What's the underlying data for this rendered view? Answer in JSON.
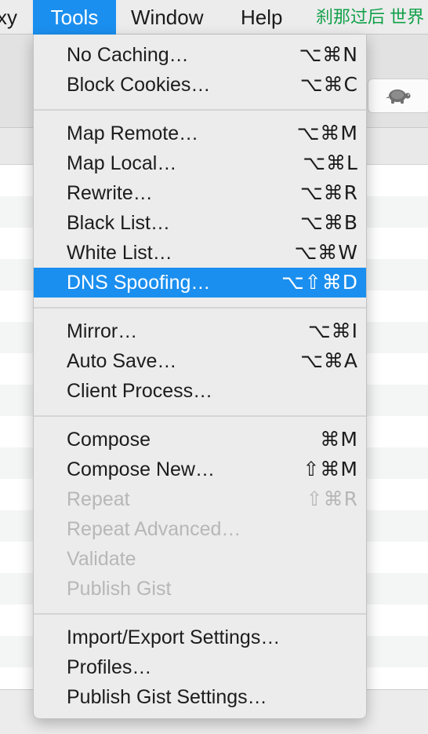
{
  "menubar": {
    "partial_label": "xy",
    "tools_label": "Tools",
    "window_label": "Window",
    "help_label": "Help",
    "status_text": "刹那过后 世界",
    "status_color": "#12a04a",
    "highlight_color": "#1b8fef"
  },
  "toolbar": {
    "throttle_icon": "turtle-icon"
  },
  "tools_menu": {
    "items": [
      {
        "label": "No Caching…",
        "shortcut": "⌥⌘N",
        "enabled": true
      },
      {
        "label": "Block Cookies…",
        "shortcut": "⌥⌘C",
        "enabled": true
      },
      {
        "label": "Map Remote…",
        "shortcut": "⌥⌘M",
        "enabled": true
      },
      {
        "label": "Map Local…",
        "shortcut": "⌥⌘L",
        "enabled": true
      },
      {
        "label": "Rewrite…",
        "shortcut": "⌥⌘R",
        "enabled": true
      },
      {
        "label": "Black List…",
        "shortcut": "⌥⌘B",
        "enabled": true
      },
      {
        "label": "White List…",
        "shortcut": "⌥⌘W",
        "enabled": true
      },
      {
        "label": "DNS Spoofing…",
        "shortcut": "⌥⇧⌘D",
        "enabled": true,
        "highlighted": true
      },
      {
        "label": "Mirror…",
        "shortcut": "⌥⌘I",
        "enabled": true
      },
      {
        "label": "Auto Save…",
        "shortcut": "⌥⌘A",
        "enabled": true
      },
      {
        "label": "Client Process…",
        "shortcut": "",
        "enabled": true
      },
      {
        "label": "Compose",
        "shortcut": "⌘M",
        "enabled": true
      },
      {
        "label": "Compose New…",
        "shortcut": "⇧⌘M",
        "enabled": true
      },
      {
        "label": "Repeat",
        "shortcut": "⇧⌘R",
        "enabled": false
      },
      {
        "label": "Repeat Advanced…",
        "shortcut": "",
        "enabled": false
      },
      {
        "label": "Validate",
        "shortcut": "",
        "enabled": false
      },
      {
        "label": "Publish Gist",
        "shortcut": "",
        "enabled": false
      },
      {
        "label": "Import/Export Settings…",
        "shortcut": "",
        "enabled": true
      },
      {
        "label": "Profiles…",
        "shortcut": "",
        "enabled": true
      },
      {
        "label": "Publish Gist Settings…",
        "shortcut": "",
        "enabled": true
      }
    ]
  }
}
